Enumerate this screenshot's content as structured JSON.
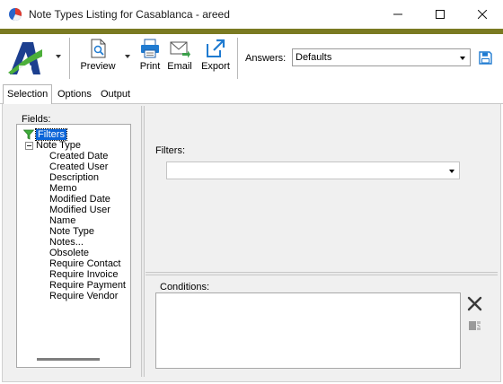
{
  "window": {
    "title": "Note Types Listing for Casablanca - areed"
  },
  "toolbar": {
    "preview_label": "Preview",
    "print_label": "Print",
    "email_label": "Email",
    "export_label": "Export",
    "answers_label": "Answers:",
    "answers_value": "Defaults"
  },
  "tabs": [
    {
      "label": "Selection",
      "selected": true
    },
    {
      "label": "Options",
      "selected": false
    },
    {
      "label": "Output",
      "selected": false
    }
  ],
  "fields": {
    "label": "Fields:",
    "root": "Filters",
    "group": "Note Type",
    "items": [
      "Created Date",
      "Created User",
      "Description",
      "Memo",
      "Modified Date",
      "Modified User",
      "Name",
      "Note Type",
      "Notes...",
      "Obsolete",
      "Require Contact",
      "Require Invoice",
      "Require Payment",
      "Require Vendor"
    ]
  },
  "filters": {
    "label": "Filters:",
    "value": ""
  },
  "conditions": {
    "label": "Conditions:"
  },
  "colors": {
    "accent_bar": "#7a7a22",
    "selection": "#0a64d8",
    "toolbar_icon_blue": "#1f7bd1"
  }
}
